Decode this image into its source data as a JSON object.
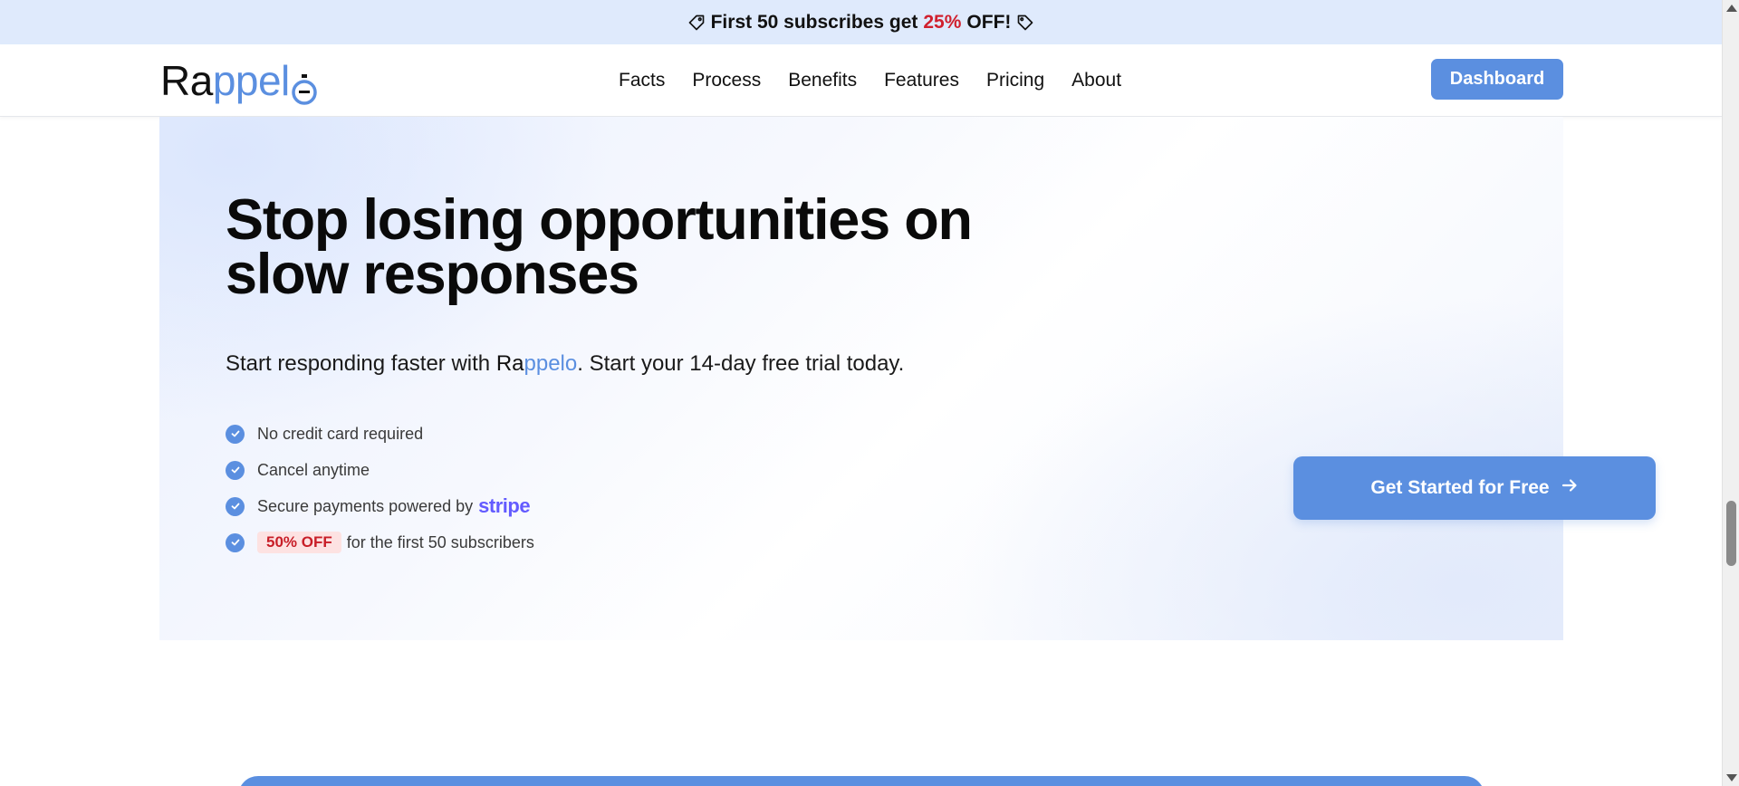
{
  "promo": {
    "part1": "First 50 subscribes get",
    "percent": "25%",
    "part2": "OFF!"
  },
  "logo": {
    "part_dark": "Ra",
    "part_blue": "ppel"
  },
  "nav": {
    "items": [
      "Facts",
      "Process",
      "Benefits",
      "Features",
      "Pricing",
      "About"
    ],
    "dashboard": "Dashboard"
  },
  "hero": {
    "title": "Stop losing opportunities on slow responses",
    "sub_prefix": "Start responding faster with ",
    "sub_brand_dark": "Ra",
    "sub_brand_blue": "ppelo",
    "sub_suffix": ". Start your 14-day free trial today.",
    "checks": {
      "c1": "No credit card required",
      "c2": "Cancel anytime",
      "c3": "Secure payments powered by",
      "c3_brand": "stripe",
      "c4_badge": "50% OFF",
      "c4_text": "for the first 50 subscribers"
    },
    "cta": "Get Started for Free"
  },
  "colors": {
    "accent": "#5b8fe0",
    "promo_bg": "#dfeafc",
    "discount_red": "#d0202e",
    "stripe": "#635bff"
  }
}
